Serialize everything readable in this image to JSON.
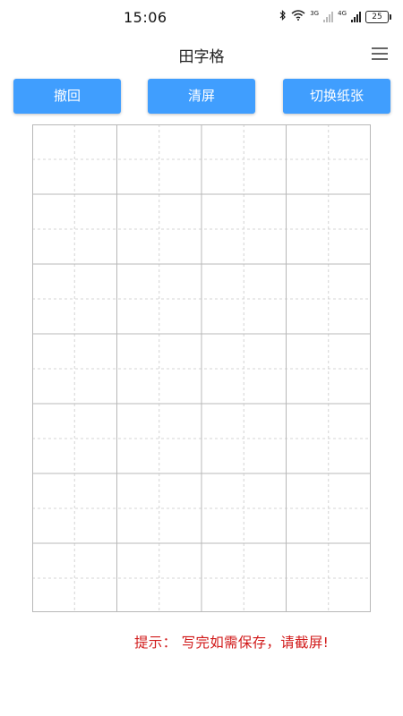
{
  "status": {
    "time": "15:06",
    "network_3g": "3G",
    "network_4g": "4G",
    "battery": "25"
  },
  "header": {
    "title": "田字格"
  },
  "toolbar": {
    "undo_label": "撤回",
    "clear_label": "清屏",
    "switch_label": "切换纸张"
  },
  "paper": {
    "type": "tianzige",
    "columns": 4,
    "rows": 7,
    "cells_visible_last_row": "partial"
  },
  "hint": {
    "text": "提示：  写完如需保存，请截屏!"
  },
  "colors": {
    "accent": "#409efe",
    "hint": "#d11a1a",
    "grid_solid": "#b8b8b8",
    "grid_dashed": "#d4d4d4"
  }
}
